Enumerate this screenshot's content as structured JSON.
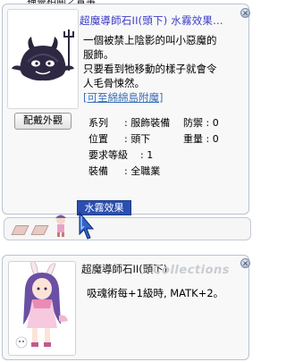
{
  "background_title": "神靈相關之實事",
  "item_window": {
    "title": "超魔導師石II(頭下) 水霧效果...",
    "close_symbol": "×",
    "appearance_button": "配戴外觀",
    "description": [
      "一個被禁上陰影的叫小惡魔的",
      "服飾。",
      "只要看到牠移動的樣子就會令",
      "人毛骨悚然。"
    ],
    "link": "[可至綿綿島附魔]",
    "stats": {
      "type_label": "系列",
      "type_value": ": 服飾裝備",
      "defense_label": "防禦",
      "defense_value": ": 0",
      "position_label": "位置",
      "position_value": ": 頭下",
      "weight_label": "重量",
      "weight_value": ": 0",
      "level_label": "要求等級",
      "level_value": ": 1",
      "job_label": "裝備",
      "job_value": ": 全職業"
    },
    "tab_label": "水霧效果"
  },
  "card_window": {
    "title": "超魔導師石II(頭下)",
    "watermark": "Collections",
    "close_symbol": "×",
    "effect": "吸魂術每+1級時, MATK+2。"
  }
}
